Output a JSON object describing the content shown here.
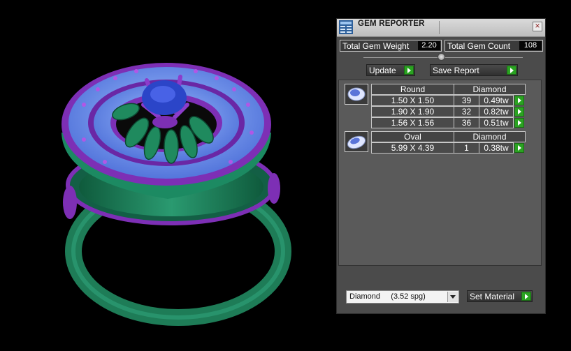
{
  "window": {
    "title": "GEM REPORTER",
    "close_glyph": "×"
  },
  "totals": {
    "weight_label": "Total Gem Weight",
    "weight_value": "2.20",
    "count_label": "Total Gem Count",
    "count_value": "108"
  },
  "toolbar": {
    "update_label": "Update",
    "save_report_label": "Save Report"
  },
  "groups": [
    {
      "shape": "Round",
      "material": "Diamond",
      "icon": "round-gem-icon",
      "rows": [
        {
          "size": "1.50 X 1.50",
          "count": "39",
          "weight": "0.49tw"
        },
        {
          "size": "1.90 X 1.90",
          "count": "32",
          "weight": "0.82tw"
        },
        {
          "size": "1.56 X 1.56",
          "count": "36",
          "weight": "0.51tw"
        }
      ]
    },
    {
      "shape": "Oval",
      "material": "Diamond",
      "icon": "oval-gem-icon",
      "rows": [
        {
          "size": "5.99 X 4.39",
          "count": "1",
          "weight": "0.38tw"
        }
      ]
    }
  ],
  "material_select": {
    "value": "Diamond     (3.52 spg)"
  },
  "set_material_label": "Set Material",
  "colors": {
    "panel": "#4b4b4b",
    "accent_green": "#2aa321",
    "ring_green": "#1f7a5a",
    "ring_purple": "#7d2fb5",
    "gem_blue": "#2b45c8"
  }
}
